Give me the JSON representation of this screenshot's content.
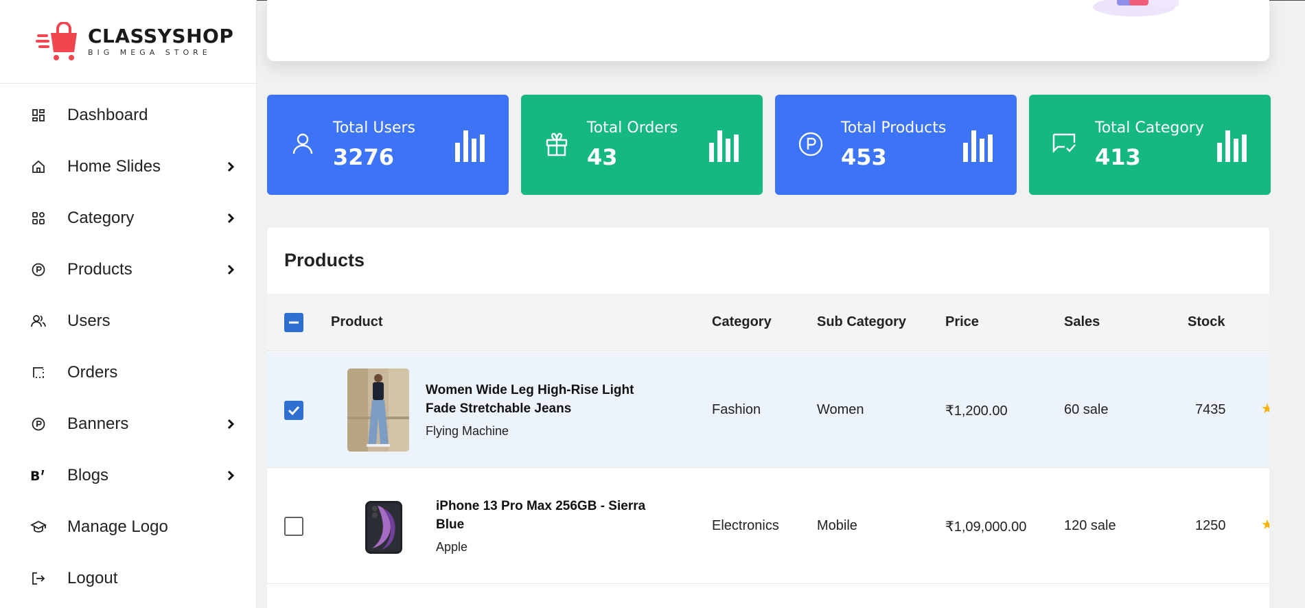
{
  "brand": {
    "name": "CLASSYSHOP",
    "tagline": "BIG MEGA STORE",
    "accent": "#f0464f"
  },
  "sidebar": {
    "items": [
      {
        "label": "Dashboard",
        "icon": "dashboard-icon",
        "has_submenu": false
      },
      {
        "label": "Home Slides",
        "icon": "home-icon",
        "has_submenu": true
      },
      {
        "label": "Category",
        "icon": "category-icon",
        "has_submenu": true
      },
      {
        "label": "Products",
        "icon": "products-icon",
        "has_submenu": true
      },
      {
        "label": "Users",
        "icon": "users-icon",
        "has_submenu": false
      },
      {
        "label": "Orders",
        "icon": "orders-icon",
        "has_submenu": false
      },
      {
        "label": "Banners",
        "icon": "banners-icon",
        "has_submenu": true
      },
      {
        "label": "Blogs",
        "icon": "blogs-icon",
        "has_submenu": true
      },
      {
        "label": "Manage Logo",
        "icon": "logo-manage-icon",
        "has_submenu": false
      },
      {
        "label": "Logout",
        "icon": "logout-icon",
        "has_submenu": false
      }
    ]
  },
  "stats": [
    {
      "label": "Total Users",
      "value": "3276",
      "icon": "user-icon",
      "color": "#3d73f5"
    },
    {
      "label": "Total Orders",
      "value": "43",
      "icon": "gift-icon",
      "color": "#15b87f"
    },
    {
      "label": "Total Products",
      "value": "453",
      "icon": "product-circle-icon",
      "color": "#3d73f5"
    },
    {
      "label": "Total Category",
      "value": "413",
      "icon": "message-check-icon",
      "color": "#15b87f"
    }
  ],
  "products_panel": {
    "title": "Products",
    "columns": [
      "Product",
      "Category",
      "Sub Category",
      "Price",
      "Sales",
      "Stock"
    ],
    "header_checkbox": "indeterminate",
    "rows": [
      {
        "name": "Women Wide Leg High-Rise Light Fade Stretchable Jeans",
        "brand": "Flying Machine",
        "category": "Fashion",
        "sub_category": "Women",
        "price": "₹1,200.00",
        "sales": "60 sale",
        "stock": "7435",
        "checked": true,
        "rating_icon": "star-icon"
      },
      {
        "name": "iPhone 13 Pro Max 256GB - Sierra Blue",
        "brand": "Apple",
        "category": "Electronics",
        "sub_category": "Mobile",
        "price": "₹1,09,000.00",
        "sales": "120 sale",
        "stock": "1250",
        "checked": false,
        "rating_icon": "star-icon"
      }
    ]
  }
}
